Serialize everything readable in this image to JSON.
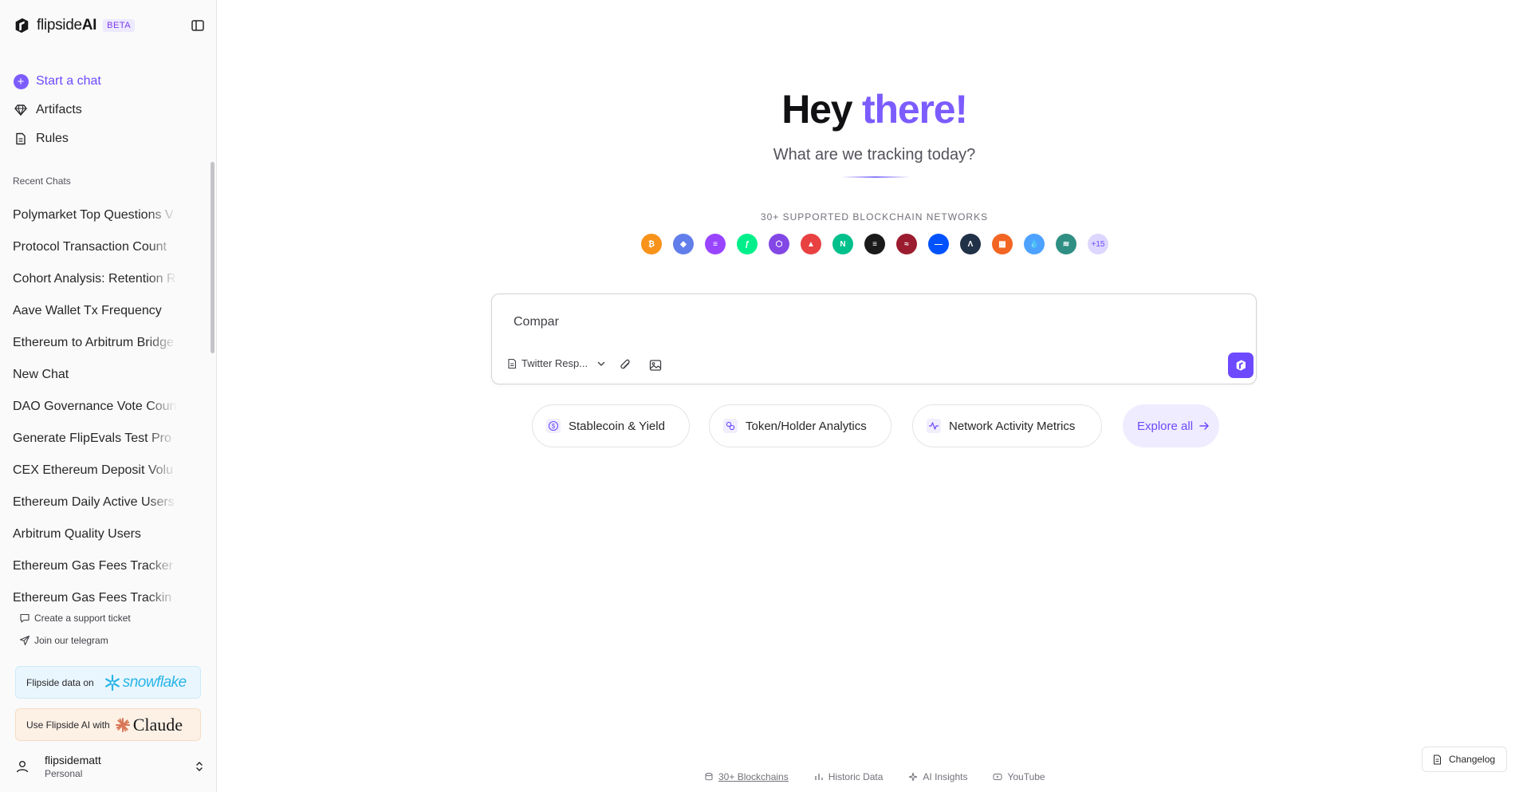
{
  "brand": {
    "name_light": "flipside",
    "name_bold": "AI",
    "badge": "BETA",
    "accent": "#7c5cff"
  },
  "nav": {
    "start_chat": "Start a chat",
    "artifacts": "Artifacts",
    "rules": "Rules"
  },
  "recent": {
    "title": "Recent Chats",
    "items": [
      "Polymarket Top Questions V",
      "Protocol Transaction Count",
      "Cohort Analysis: Retention R",
      "Aave Wallet Tx Frequency",
      "Ethereum to Arbitrum Bridge",
      "New Chat",
      "DAO Governance Vote Coun",
      "Generate FlipEvals Test Pro",
      "CEX Ethereum Deposit Volu",
      "Ethereum Daily Active Users",
      "Arbitrum Quality Users",
      "Ethereum Gas Fees Tracker",
      "Ethereum Gas Fees Trackin"
    ]
  },
  "support": {
    "ticket": "Create a support ticket",
    "telegram": "Join our telegram"
  },
  "promos": {
    "snowflake_prefix": "Flipside data on",
    "snowflake_word": "snowflake",
    "claude_prefix": "Use Flipside AI with",
    "claude_word": "Claude"
  },
  "user": {
    "name": "flipsidematt",
    "type": "Personal"
  },
  "hero": {
    "greeting": "Hey",
    "greeting_accent": "there!",
    "subtitle": "What are we tracking today?"
  },
  "networks": {
    "label": "30+ SUPPORTED BLOCKCHAIN NETWORKS",
    "chains": [
      {
        "icon": "bitcoin-icon",
        "color": "#f7931a",
        "glyph": "₿"
      },
      {
        "icon": "ethereum-icon",
        "color": "#627eea",
        "glyph": "◆"
      },
      {
        "icon": "solana-icon",
        "color": "#9945ff",
        "glyph": "≡"
      },
      {
        "icon": "flow-icon",
        "color": "#00ef8b",
        "glyph": "ƒ"
      },
      {
        "icon": "polygon-icon",
        "color": "#8247e5",
        "glyph": "⬡"
      },
      {
        "icon": "avalanche-icon",
        "color": "#e84142",
        "glyph": "▲"
      },
      {
        "icon": "near-icon",
        "color": "#00c08b",
        "glyph": "N"
      },
      {
        "icon": "aptos-icon",
        "color": "#1a1a1a",
        "glyph": "≡"
      },
      {
        "icon": "sei-icon",
        "color": "#9b1c2e",
        "glyph": "≈"
      },
      {
        "icon": "base-icon",
        "color": "#0052ff",
        "glyph": "—"
      },
      {
        "icon": "arbitrum-icon",
        "color": "#213147",
        "glyph": "Λ"
      },
      {
        "icon": "mantle-icon",
        "color": "#f26522",
        "glyph": "▦"
      },
      {
        "icon": "sui-icon",
        "color": "#4da2ff",
        "glyph": "💧"
      },
      {
        "icon": "kaia-icon",
        "color": "#2f8f83",
        "glyph": "≋"
      }
    ],
    "more": "+15"
  },
  "composer": {
    "value": "Compar",
    "template": "Twitter Resp..."
  },
  "chips": {
    "stablecoin": "Stablecoin & Yield",
    "token": "Token/Holder Analytics",
    "network": "Network Activity Metrics",
    "explore": "Explore all"
  },
  "footer": {
    "blockchains": "30+ Blockchains",
    "historic": "Historic Data",
    "insights": "AI Insights",
    "youtube": "YouTube"
  },
  "changelog": "Changelog"
}
